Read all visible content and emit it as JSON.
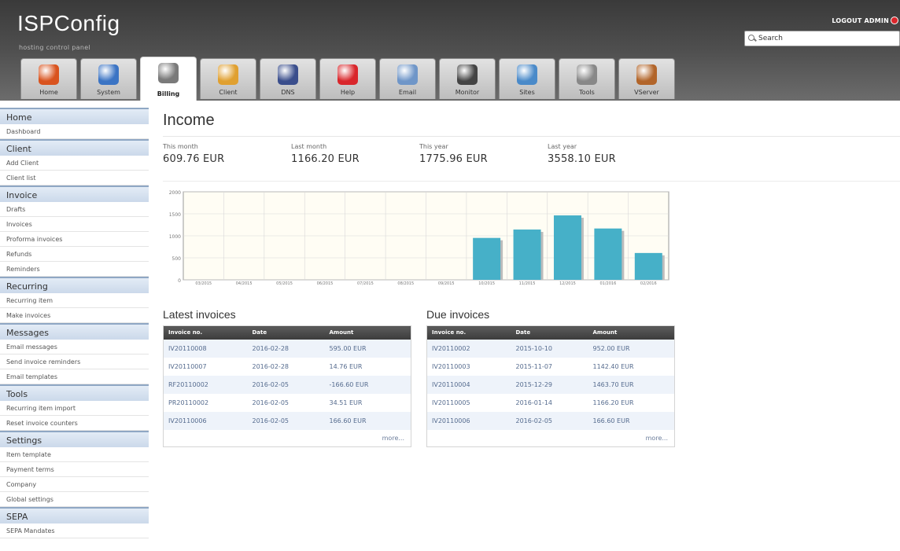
{
  "header": {
    "logo": "ISPConfig",
    "tagline": "hosting control panel",
    "logout_label": "LOGOUT ADMIN",
    "search_placeholder": "Search"
  },
  "tabs": [
    {
      "label": "Home",
      "icon": "home-icon",
      "color": "#d9531e"
    },
    {
      "label": "System",
      "icon": "system-icon",
      "color": "#3b74c4"
    },
    {
      "label": "Billing",
      "icon": "billing-calculator-icon",
      "color": "#7a7a7a",
      "active": true
    },
    {
      "label": "Client",
      "icon": "client-users-icon",
      "color": "#e0a030"
    },
    {
      "label": "DNS",
      "icon": "dns-icon",
      "color": "#3a4e8c"
    },
    {
      "label": "Help",
      "icon": "help-lifebuoy-icon",
      "color": "#d9262b"
    },
    {
      "label": "Email",
      "icon": "email-icon",
      "color": "#6f96c8"
    },
    {
      "label": "Monitor",
      "icon": "monitor-traffic-light-icon",
      "color": "#444444"
    },
    {
      "label": "Sites",
      "icon": "sites-icon",
      "color": "#4a8ac9"
    },
    {
      "label": "Tools",
      "icon": "tools-icon",
      "color": "#888888"
    },
    {
      "label": "VServer",
      "icon": "vserver-icon",
      "color": "#b2652a"
    }
  ],
  "sidebar": [
    {
      "title": "Home",
      "items": [
        "Dashboard"
      ]
    },
    {
      "title": "Client",
      "items": [
        "Add Client",
        "Client list"
      ]
    },
    {
      "title": "Invoice",
      "items": [
        "Drafts",
        "Invoices",
        "Proforma invoices",
        "Refunds",
        "Reminders"
      ]
    },
    {
      "title": "Recurring",
      "items": [
        "Recurring item",
        "Make invoices"
      ]
    },
    {
      "title": "Messages",
      "items": [
        "Email messages",
        "Send invoice reminders",
        "Email templates"
      ]
    },
    {
      "title": "Tools",
      "items": [
        "Recurring item import",
        "Reset invoice counters"
      ]
    },
    {
      "title": "Settings",
      "items": [
        "Item template",
        "Payment terms",
        "Company",
        "Global settings"
      ]
    },
    {
      "title": "SEPA",
      "items": [
        "SEPA Mandates"
      ]
    }
  ],
  "main": {
    "title": "Income",
    "stats": [
      {
        "label": "This month",
        "value": "609.76 EUR"
      },
      {
        "label": "Last month",
        "value": "1166.20 EUR"
      },
      {
        "label": "This year",
        "value": "1775.96 EUR"
      },
      {
        "label": "Last year",
        "value": "3558.10 EUR"
      }
    ]
  },
  "chart_data": {
    "type": "bar",
    "categories": [
      "03/2015",
      "04/2015",
      "05/2015",
      "06/2015",
      "07/2015",
      "08/2015",
      "09/2015",
      "10/2015",
      "11/2015",
      "12/2015",
      "01/2016",
      "02/2016"
    ],
    "values": [
      0,
      0,
      0,
      0,
      0,
      0,
      0,
      952.0,
      1142.4,
      1463.7,
      1166.2,
      609.76
    ],
    "ylim": [
      0,
      2000
    ],
    "yticks": [
      0,
      500,
      1000,
      1500,
      2000
    ],
    "bar_color": "#46b0c8",
    "grid": true
  },
  "latest_invoices": {
    "title": "Latest invoices",
    "columns": [
      "Invoice no.",
      "Date",
      "Amount"
    ],
    "rows": [
      [
        "IV20110008",
        "2016-02-28",
        "595.00 EUR"
      ],
      [
        "IV20110007",
        "2016-02-28",
        "14.76 EUR"
      ],
      [
        "RF20110002",
        "2016-02-05",
        "-166.60 EUR"
      ],
      [
        "PR20110002",
        "2016-02-05",
        "34.51 EUR"
      ],
      [
        "IV20110006",
        "2016-02-05",
        "166.60 EUR"
      ]
    ],
    "more": "more..."
  },
  "due_invoices": {
    "title": "Due invoices",
    "columns": [
      "Invoice no.",
      "Date",
      "Amount"
    ],
    "rows": [
      [
        "IV20110002",
        "2015-10-10",
        "952.00 EUR"
      ],
      [
        "IV20110003",
        "2015-11-07",
        "1142.40 EUR"
      ],
      [
        "IV20110004",
        "2015-12-29",
        "1463.70 EUR"
      ],
      [
        "IV20110005",
        "2016-01-14",
        "1166.20 EUR"
      ],
      [
        "IV20110006",
        "2016-02-05",
        "166.60 EUR"
      ]
    ],
    "more": "more..."
  }
}
